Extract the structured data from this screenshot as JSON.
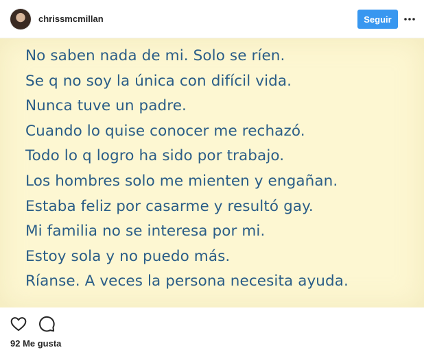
{
  "header": {
    "username": "chrissmcmillan",
    "follow_label": "Seguir"
  },
  "post": {
    "note_lines": [
      "No saben nada de mi. Solo se ríen.",
      "Se q no soy la única con difícil vida.",
      "Nunca tuve un padre.",
      "Cuando lo quise conocer me rechazó.",
      "Todo lo q logro ha sido por trabajo.",
      "Los hombres solo me mienten y engañan.",
      "Estaba feliz por casarme y resultó gay.",
      "Mi familia no se interesa por mi.",
      "Estoy sola y no puedo más.",
      "Ríanse. A veces la persona necesita ayuda."
    ]
  },
  "footer": {
    "likes_text": "92 Me gusta"
  },
  "colors": {
    "follow_button": "#3897f0",
    "note_background": "#fdf7d2",
    "note_text": "#2a5d87"
  },
  "icons": {
    "avatar": "profile-photo",
    "more": "ellipsis-icon",
    "like": "heart-icon",
    "comment": "comment-icon"
  }
}
